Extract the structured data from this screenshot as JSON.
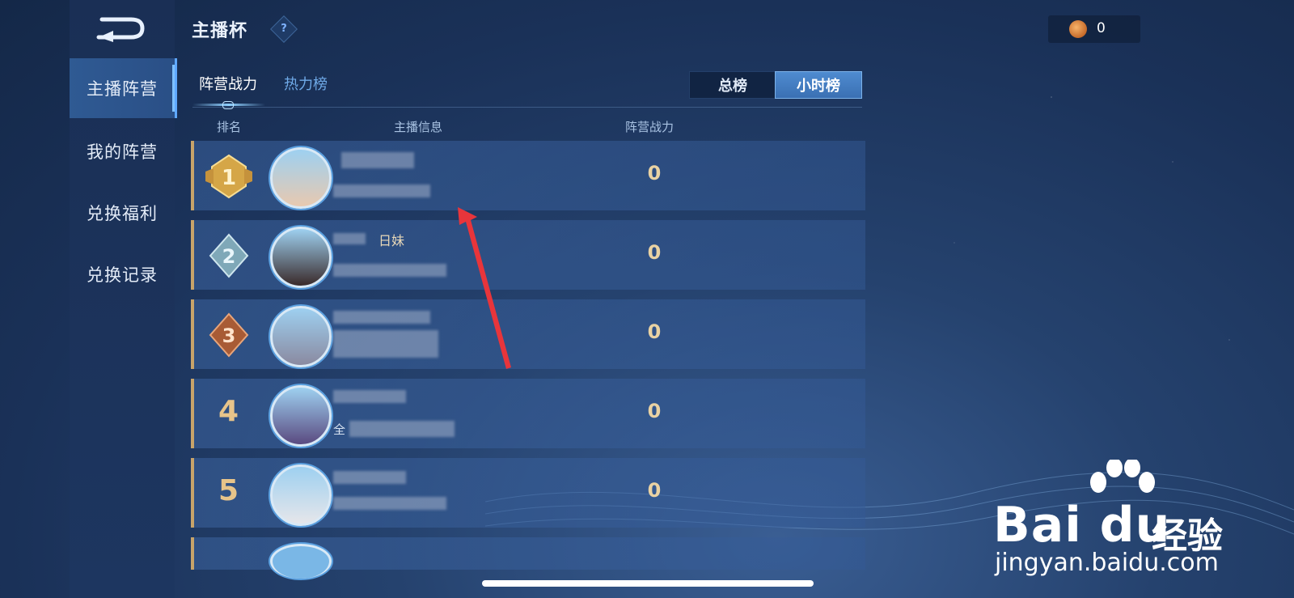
{
  "header": {
    "title": "主播杯",
    "help_icon": "question-icon"
  },
  "currency": {
    "value": "0",
    "icon": "coin-icon"
  },
  "sidebar": {
    "items": [
      {
        "label": "主播阵营",
        "active": true
      },
      {
        "label": "我的阵营",
        "active": false
      },
      {
        "label": "兑换福利",
        "active": false
      },
      {
        "label": "兑换记录",
        "active": false
      }
    ]
  },
  "tabs": [
    {
      "label": "阵营战力",
      "active": true
    },
    {
      "label": "热力榜",
      "active": false
    }
  ],
  "segment": {
    "total_label": "总榜",
    "hour_label": "小时榜",
    "selected": "小时榜"
  },
  "table": {
    "headers": {
      "rank": "排名",
      "info": "主播信息",
      "power": "阵营战力"
    },
    "rows": [
      {
        "rank": "1",
        "name": "",
        "sub": "",
        "power": "0"
      },
      {
        "rank": "2",
        "name": "日妹",
        "sub": "",
        "power": "0"
      },
      {
        "rank": "3",
        "name": "",
        "sub": "",
        "power": "0"
      },
      {
        "rank": "4",
        "name": "",
        "sub": "全",
        "power": "0"
      },
      {
        "rank": "5",
        "name": "",
        "sub": "",
        "power": "0"
      }
    ]
  },
  "watermark": {
    "brand": "Bai du",
    "suffix": "经验",
    "url": "jingyan.baidu.com"
  },
  "colors": {
    "accent": "#5fa8ff",
    "gold": "#e9d2a3",
    "bg": "#1a3158"
  }
}
